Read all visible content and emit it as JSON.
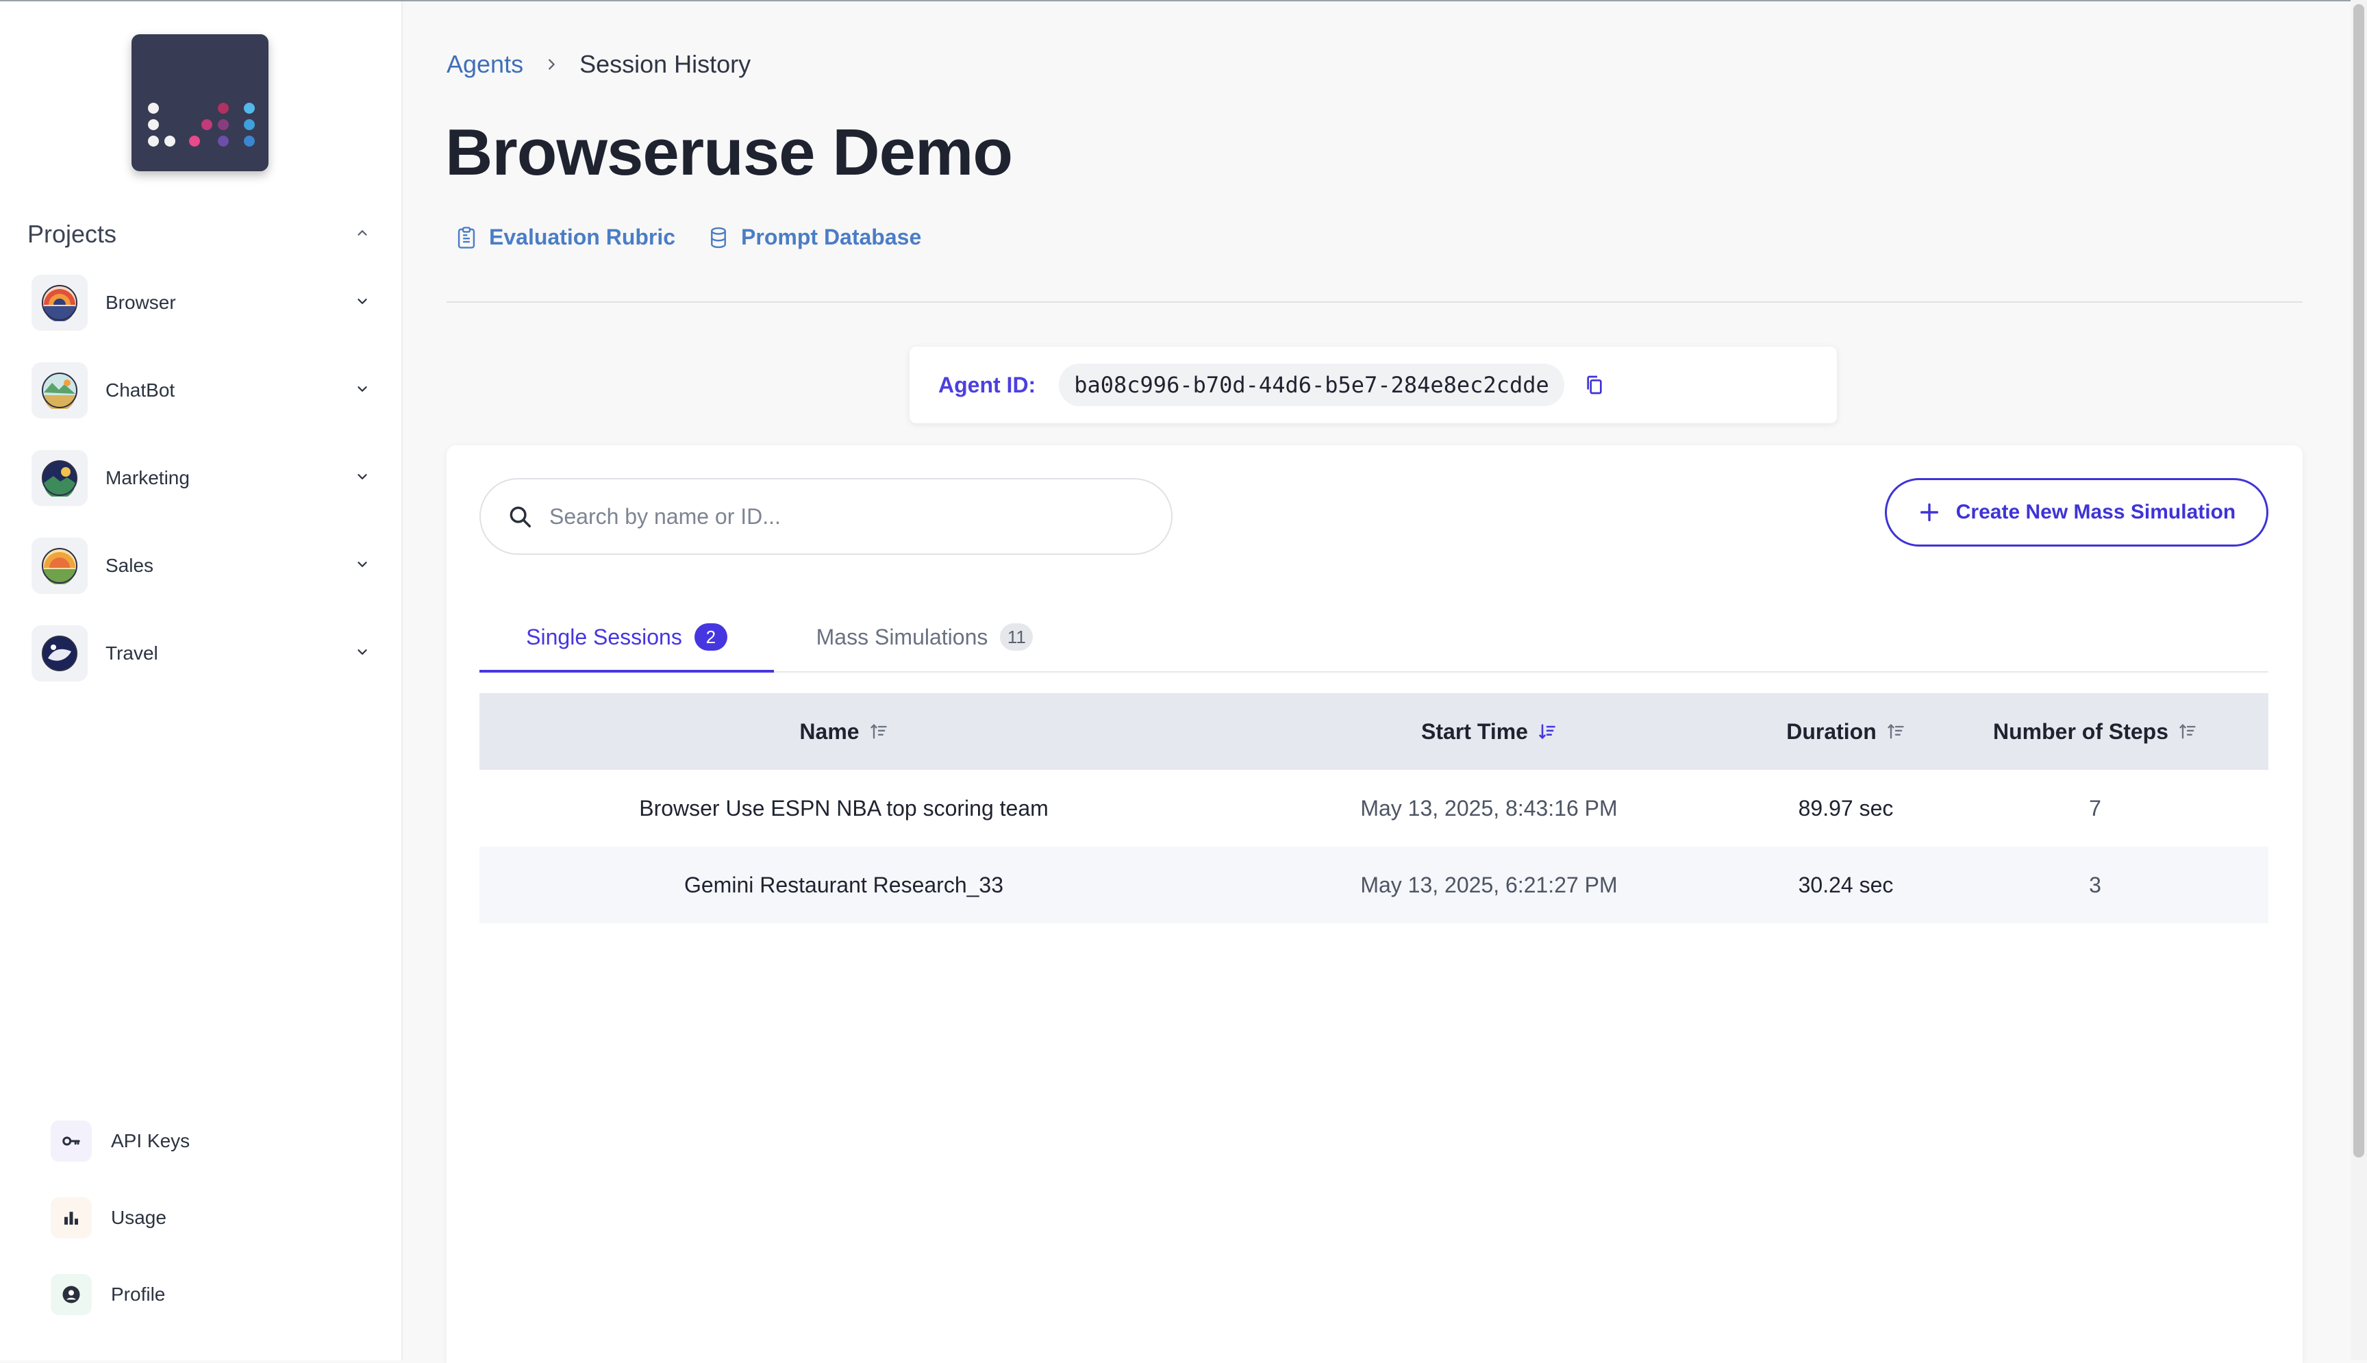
{
  "sidebar": {
    "projects_title": "Projects",
    "projects": [
      {
        "label": "Browser",
        "icon": "browser-project-icon"
      },
      {
        "label": "ChatBot",
        "icon": "chatbot-project-icon"
      },
      {
        "label": "Marketing",
        "icon": "marketing-project-icon"
      },
      {
        "label": "Sales",
        "icon": "sales-project-icon"
      },
      {
        "label": "Travel",
        "icon": "travel-project-icon"
      }
    ],
    "bottom": [
      {
        "label": "API Keys",
        "icon": "key-icon"
      },
      {
        "label": "Usage",
        "icon": "bar-chart-icon"
      },
      {
        "label": "Profile",
        "icon": "user-icon"
      }
    ]
  },
  "breadcrumb": {
    "parent": "Agents",
    "current": "Session History"
  },
  "page": {
    "title": "Browseruse Demo"
  },
  "links": {
    "rubric": "Evaluation Rubric",
    "prompts": "Prompt Database"
  },
  "agent": {
    "label": "Agent ID:",
    "id": "ba08c996-b70d-44d6-b5e7-284e8ec2cdde"
  },
  "search": {
    "placeholder": "Search by name or ID..."
  },
  "create_button": "Create New Mass Simulation",
  "tabs": [
    {
      "label": "Single Sessions",
      "count": "2",
      "active": true
    },
    {
      "label": "Mass Simulations",
      "count": "11",
      "active": false
    }
  ],
  "table": {
    "headers": {
      "name": "Name",
      "start": "Start Time",
      "duration": "Duration",
      "steps": "Number of Steps"
    },
    "rows": [
      {
        "name": "Browser Use ESPN NBA top scoring team",
        "start": "May 13, 2025, 8:43:16 PM",
        "duration": "89.97 sec",
        "steps": "7"
      },
      {
        "name": "Gemini Restaurant Research_33",
        "start": "May 13, 2025, 6:21:27 PM",
        "duration": "30.24 sec",
        "steps": "3"
      }
    ]
  },
  "colors": {
    "accent": "#4636e0",
    "link": "#3f6fb7",
    "logo_bg": "#373b54"
  }
}
